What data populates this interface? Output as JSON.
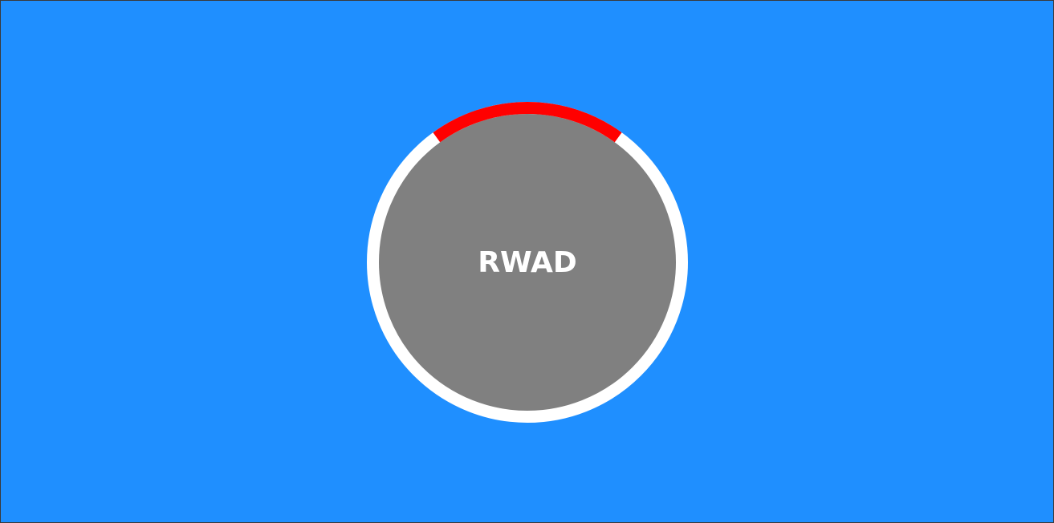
{
  "loader": {
    "label": "RWAD",
    "progress_arc_fraction": 0.2,
    "colors": {
      "background": "#1f8fff",
      "ring": "#ffffff",
      "progress": "#ff0000",
      "disc": "#808080",
      "label": "#ffffff"
    }
  }
}
